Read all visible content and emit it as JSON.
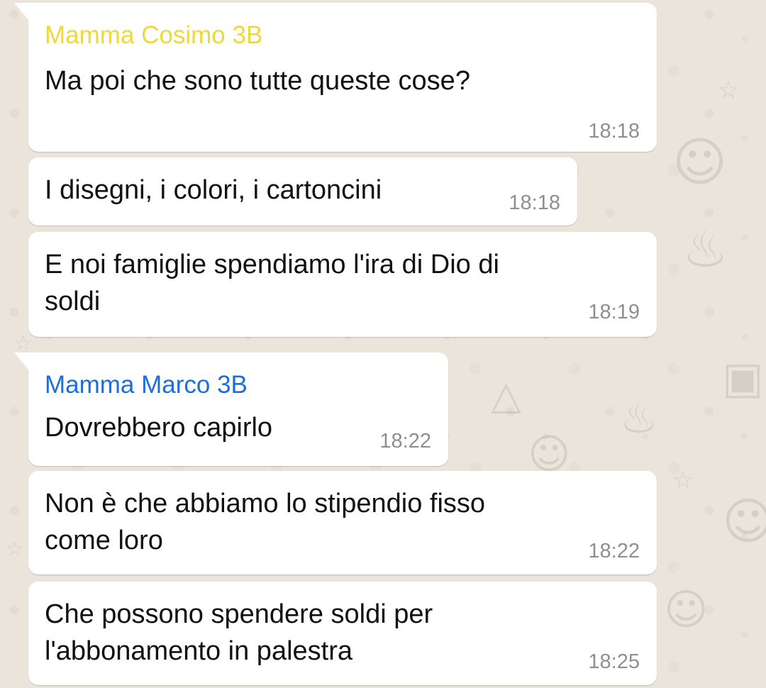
{
  "chat": {
    "messages": [
      {
        "sender": "Mamma Cosimo 3B",
        "sender_color": "#f0d73a",
        "text": "Ma poi che sono tutte queste cose?",
        "time": "18:18"
      },
      {
        "text": "I disegni, i colori, i cartoncini",
        "time": "18:18"
      },
      {
        "text": "E noi famiglie spendiamo l'ira di Dio di\nsoldi",
        "time": "18:19"
      },
      {
        "sender": "Mamma Marco 3B",
        "sender_color": "#1d6fd6",
        "text": "Dovrebbero capirlo",
        "time": "18:22"
      },
      {
        "text": "Non è che abbiamo lo stipendio fisso\ncome loro",
        "time": "18:22"
      },
      {
        "text": "Che possono spendere soldi per\nl'abbonamento in palestra",
        "time": "18:25"
      }
    ]
  },
  "colors": {
    "bubble_background": "#ffffff",
    "chat_background": "#ebe4da",
    "time_text": "#8f8f8f"
  },
  "icons": [
    "cake-doodle-icon",
    "cat-doodle-icon",
    "star-doodle-icon",
    "gift-doodle-icon",
    "party-hat-doodle-icon"
  ]
}
